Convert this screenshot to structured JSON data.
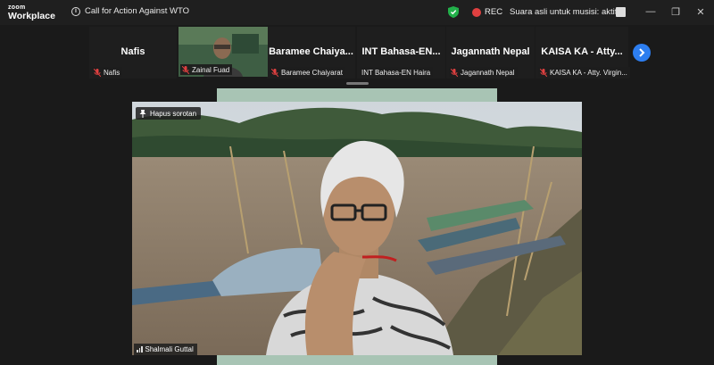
{
  "app": {
    "brand_top": "zoom",
    "brand_bottom": "Workplace"
  },
  "meeting": {
    "title": "Call for Action Against WTO"
  },
  "status": {
    "rec_label": "REC",
    "audio_text": "Suara asli untuk musisi: aktif"
  },
  "window": {
    "minimize": "—",
    "restore": "❐",
    "close": "✕"
  },
  "participants": [
    {
      "display": "Nafis",
      "label": "Nafis"
    },
    {
      "display": "",
      "label": "Zainal Fuad"
    },
    {
      "display": "Baramee Chaiya...",
      "label": "Baramee Chaiyarat"
    },
    {
      "display": "INT Bahasa-EN...",
      "label": "INT Bahasa-EN Haira"
    },
    {
      "display": "Jagannath Nepal",
      "label": "Jagannath Nepal"
    },
    {
      "display": "KAISA KA - Atty...",
      "label": "KAISA KA - Atty. Virgin..."
    }
  ],
  "spotlight": {
    "unpin_label": "Hapus sorotan",
    "speaker_name": "Shalmali Guttal"
  },
  "colors": {
    "accent": "#2d7ef0",
    "rec": "#e04040",
    "shield": "#22b04a",
    "muted": "#e04040"
  }
}
